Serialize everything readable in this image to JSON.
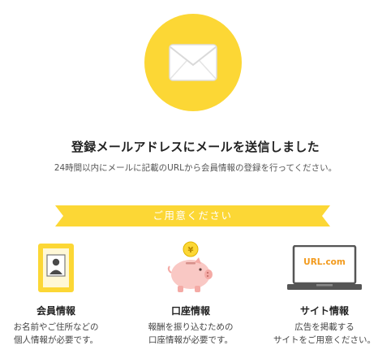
{
  "hero": {
    "icon": "mail-envelope-icon",
    "accent": "#fcd735"
  },
  "title": "登録メールアドレスにメールを送信しました",
  "subtitle": "24時間以内にメールに記載のURLから会員情報の登録を行ってください。",
  "ribbon": {
    "label": "ご用意ください",
    "color": "#fcd735"
  },
  "features": [
    {
      "icon": "member-card-icon",
      "title": "会員情報",
      "desc": [
        "お名前やご住所などの",
        "個人情報が必要です。"
      ]
    },
    {
      "icon": "piggy-bank-icon",
      "title": "口座情報",
      "desc": [
        "報酬を振り込むための",
        "口座情報が必要です。"
      ]
    },
    {
      "icon": "laptop-icon",
      "title": "サイト情報",
      "desc": [
        "広告を掲載する",
        "サイトをご用意ください。"
      ],
      "screen_text": "URL.com"
    }
  ]
}
